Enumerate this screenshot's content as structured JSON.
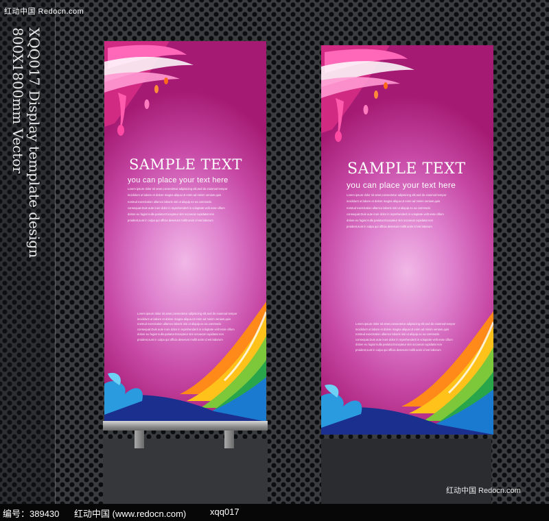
{
  "watermark_top": "红动中国 Redocn.com",
  "side_title": {
    "line1": "XQQ017 Display template design",
    "line2": "800X1800mm Vector"
  },
  "banners": [
    {
      "title": "SAMPLE TEXT",
      "subtitle": "you can place your text here",
      "body_lines": [
        "Lorem ipsum dolor sit amet,consectetur adipisicing elit,sed do eiusmod tempor",
        "incididunt ut labore et dolore magna aliqua.Ut enim ad minim veniam,quis",
        "nostrud exercitation ullamco laboris nisi ut aliquip ex ea commodo",
        "consequat.Duis aute irure dolor in reprehenderit in voluptate velit esse cillum",
        "dolore eu fugiat nulla pariatur.Excepteur sint occaecat cupidatat non",
        "proident,sunt in culpa qui officia deserunt mollit anim id est laborum"
      ],
      "lower_lines": [
        "Lorem ipsum dolor sit amet,consectetur adipisicing elit,sed do eiusmod tempor",
        "incididunt ut labore et dolore magna aliqua.Ut enim ad minim veniam,quis",
        "nostrud exercitation ullamco laboris nisi ut aliquip ex ea commodo",
        "consequat.Duis aute irure dolor in reprehenderit in voluptate velit esse cillum",
        "dolore eu fugiat nulla pariatur.Excepteur sint occaecat cupidatat non",
        "proident,sunt in culpa qui officia deserunt mollit anim id est laborum"
      ]
    },
    {
      "title": "SAMPLE TEXT",
      "subtitle": "you can place your text here",
      "body_lines": [
        "Lorem ipsum dolor sit amet,consectetur adipisicing elit,sed do eiusmod tempor",
        "incididunt ut labore et dolore magna aliqua.Ut enim ad minim veniam,quis",
        "nostrud exercitation ullamco laboris nisi ut aliquip ex ea commodo",
        "consequat.Duis aute irure dolor in reprehenderit in voluptate velit esse cillum",
        "dolore eu fugiat nulla pariatur.Excepteur sint occaecat cupidatat non",
        "proident,sunt in culpa qui officia deserunt mollit anim id est laborum"
      ],
      "lower_lines": [
        "Lorem ipsum dolor sit amet,consectetur adipisicing elit,sed do eiusmod tempor",
        "incididunt ut labore et dolore magna aliqua.Ut enim ad minim veniam,quis",
        "nostrud exercitation ullamco laboris nisi ut aliquip ex ea commodo",
        "consequat.Duis aute irure dolor in reprehenderit in voluptate velit esse cillum",
        "dolore eu fugiat nulla pariatur.Excepteur sint occaecat cupidatat non",
        "proident,sunt in culpa qui officia deserunt mollit anim id est laborum"
      ]
    }
  ],
  "watermark_bottom_right": "红动中国 Redocn.com",
  "footer": {
    "id_text": "编号：389430",
    "site_text": "红动中国 (www.redocn.com)",
    "code_text": "xqq017"
  },
  "colors": {
    "banner_dark": "#a51b73",
    "banner_light": "#f1b7e6",
    "background": "#3a3c3f"
  }
}
